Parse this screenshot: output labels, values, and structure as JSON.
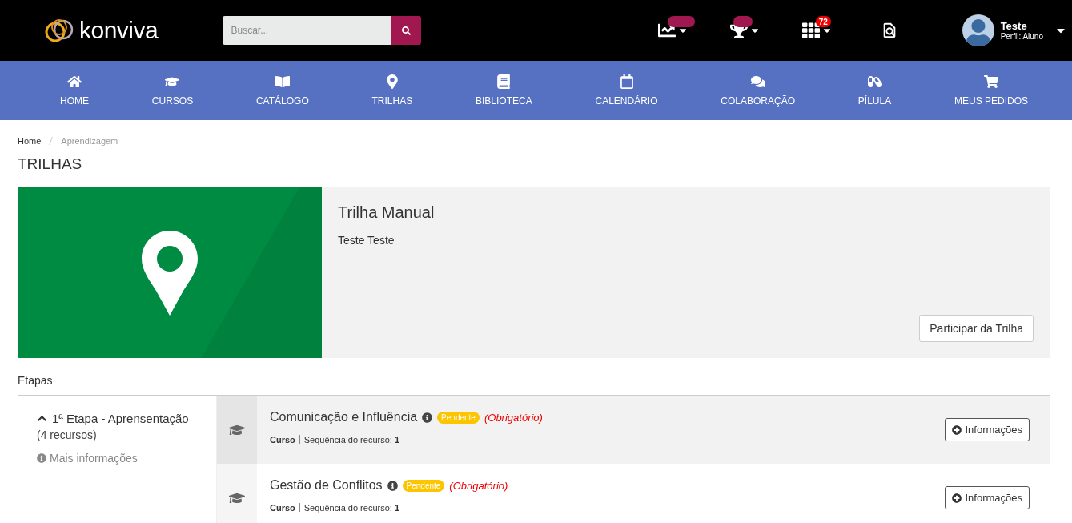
{
  "header": {
    "logo": "konviva",
    "search": {
      "placeholder": "Buscar..."
    },
    "tools": [
      {
        "kind": "chart",
        "badge": true
      },
      {
        "kind": "trophy",
        "badge": true
      },
      {
        "kind": "apps",
        "count": "72"
      },
      {
        "kind": "report"
      }
    ],
    "user": {
      "name": "Teste",
      "profile": "Perfil: Aluno"
    }
  },
  "nav": [
    {
      "label": "HOME"
    },
    {
      "label": "CURSOS"
    },
    {
      "label": "CATÁLOGO"
    },
    {
      "label": "TRILHAS"
    },
    {
      "label": "BIBLIOTECA"
    },
    {
      "label": "CALENDÁRIO"
    },
    {
      "label": "COLABORAÇÃO"
    },
    {
      "label": "PÍLULA"
    },
    {
      "label": "MEUS PEDIDOS"
    }
  ],
  "breadcrumb": [
    {
      "label": "Home",
      "current": false
    },
    {
      "label": "Aprendizagem",
      "current": true
    }
  ],
  "page_title": "TRILHAS",
  "trail": {
    "title": "Trilha Manual",
    "description": "Teste Teste",
    "button": "Participar da Trilha"
  },
  "stages_title": "Etapas",
  "stage": {
    "title": "1ª Etapa - Aprensentação",
    "expanded": true,
    "resources": "(4 recursos)",
    "more": "Mais informações"
  },
  "resources": [
    {
      "title": "Comunicação e Influência",
      "status": "Pendente",
      "required": "(Obrigatório)",
      "type": "Curso",
      "sequence_label": "Sequência do recurso:",
      "sequence": "1",
      "button": "Informações",
      "highlighted": true
    },
    {
      "title": "Gestão de Conflitos",
      "status": "Pendente",
      "required": "(Obrigatório)",
      "type": "Curso",
      "sequence_label": "Sequência do recurso:",
      "sequence": "1",
      "button": "Informações",
      "highlighted": false
    }
  ]
}
